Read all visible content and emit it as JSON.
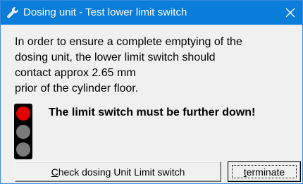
{
  "window": {
    "title": "Dosing unit  -  Test lower limit switch",
    "title_icon": "wrench-icon",
    "close_glyph": "✕"
  },
  "message": {
    "lines": [
      "In order to ensure a complete emptying of the",
      "dosing unit, the lower limit switch should",
      "contact approx 2.65 mm",
      "prior of the cylinder floor."
    ]
  },
  "status": {
    "indicator": "traffic-light",
    "active_lamp": "red",
    "colors": {
      "red": "#e50000",
      "off": "#7a7a7a",
      "housing": "#000000"
    },
    "text": "The limit switch must be further down!"
  },
  "buttons": {
    "check": {
      "mnemonic": "C",
      "rest": "heck dosing Unit Limit switch"
    },
    "terminate": {
      "mnemonic": "t",
      "rest": "erminate"
    }
  },
  "colors": {
    "titlebar": "#0a7cd9",
    "background": "#f0f0f0"
  }
}
